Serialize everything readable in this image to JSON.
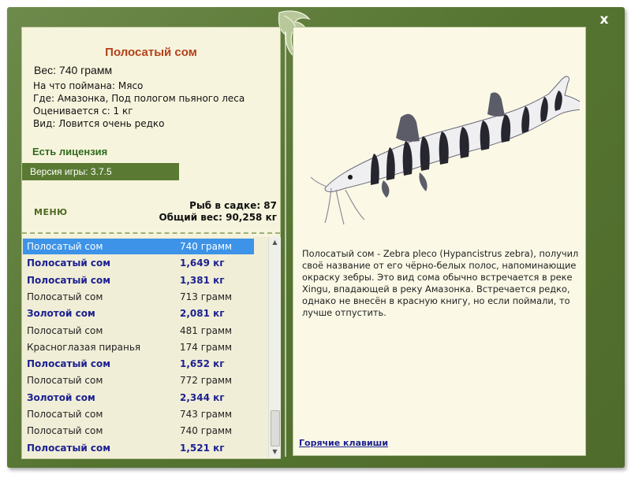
{
  "window": {
    "close_label": "x"
  },
  "fish": {
    "title": "Полосатый сом",
    "weight": "Вес: 740 грамм",
    "caught_with": "На что поймана: Мясо",
    "location": "Где: Амазонка, Под пологом пьяного леса",
    "value": "Оценивается с: 1 кг",
    "rarity": "Вид: Ловится очень редко",
    "description": "Полосатый сом - Zebra pleco (Hypancistrus zebra), получил своё название от его чёрно-белых полос, напоминающие окраску зебры. Это вид сома обычно встречается в реке Xingu, впадающей в реку Амазонка. Встречается редко, однако не внесён в красную книгу, но если поймали, то лучше отпустить."
  },
  "license": "Есть лицензия",
  "version": "Версия игры: 3.7.5",
  "menu_label": "МЕНЮ",
  "stats": {
    "fish_count": "Рыб в садке: 87",
    "total_weight": "Общий вес: 90,258 кг"
  },
  "catch_list": [
    {
      "name": "Полосатый сом",
      "weight": "740 грамм",
      "style": "selected"
    },
    {
      "name": "Полосатый сом",
      "weight": "1,649 кг",
      "style": "bold"
    },
    {
      "name": "Полосатый сом",
      "weight": "1,381 кг",
      "style": "bold"
    },
    {
      "name": "Полосатый сом",
      "weight": "713 грамм",
      "style": "plain"
    },
    {
      "name": "Золотой сом",
      "weight": "2,081 кг",
      "style": "bold"
    },
    {
      "name": "Полосатый сом",
      "weight": "481 грамм",
      "style": "plain"
    },
    {
      "name": "Красноглазая пиранья",
      "weight": "174 грамм",
      "style": "plain"
    },
    {
      "name": "Полосатый сом",
      "weight": "1,652 кг",
      "style": "bold"
    },
    {
      "name": "Полосатый сом",
      "weight": "772 грамм",
      "style": "plain"
    },
    {
      "name": "Золотой сом",
      "weight": "2,344 кг",
      "style": "bold"
    },
    {
      "name": "Полосатый сом",
      "weight": "743 грамм",
      "style": "plain"
    },
    {
      "name": "Полосатый сом",
      "weight": "740 грамм",
      "style": "plain"
    },
    {
      "name": "Полосатый сом",
      "weight": "1,521 кг",
      "style": "bold"
    }
  ],
  "hotkeys_label": "Горячие клавиши",
  "colors": {
    "frame": "#5a7a33",
    "panel_bg": "#f7f4dd",
    "title_red": "#b3401a",
    "license_green": "#2f6a1c",
    "list_bold_blue": "#1d2290",
    "selection_blue": "#3d93e8"
  },
  "icons": {
    "close": "close-icon",
    "logo": "leaf-logo-icon",
    "scroll_up": "scroll-up-arrow-icon",
    "scroll_down": "scroll-down-arrow-icon"
  }
}
